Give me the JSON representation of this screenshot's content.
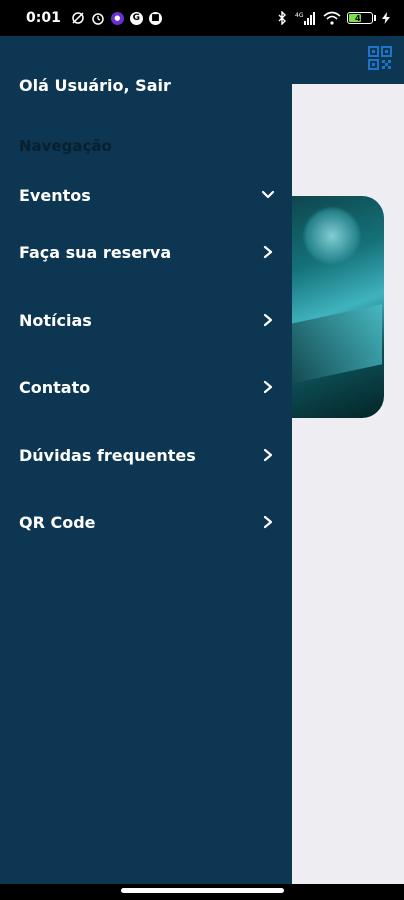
{
  "status_bar": {
    "time": "0:01",
    "network": "4G",
    "battery_level": "48",
    "battery_fraction": 0.48
  },
  "header": {
    "qr_icon": "qr-code-icon",
    "accent_color": "#1e74c9"
  },
  "drawer": {
    "greeting": "Olá Usuário, Sair",
    "section_title": "Navegação",
    "items": [
      {
        "label": "Eventos",
        "icon": "chevron-down-icon"
      },
      {
        "label": "Faça sua reserva",
        "icon": "chevron-right-icon"
      },
      {
        "label": "Notícias",
        "icon": "chevron-right-icon"
      },
      {
        "label": "Contato",
        "icon": "chevron-right-icon"
      },
      {
        "label": "Dúvidas frequentes",
        "icon": "chevron-right-icon"
      },
      {
        "label": "QR Code",
        "icon": "chevron-right-icon"
      }
    ],
    "background_color": "#0c3651"
  }
}
